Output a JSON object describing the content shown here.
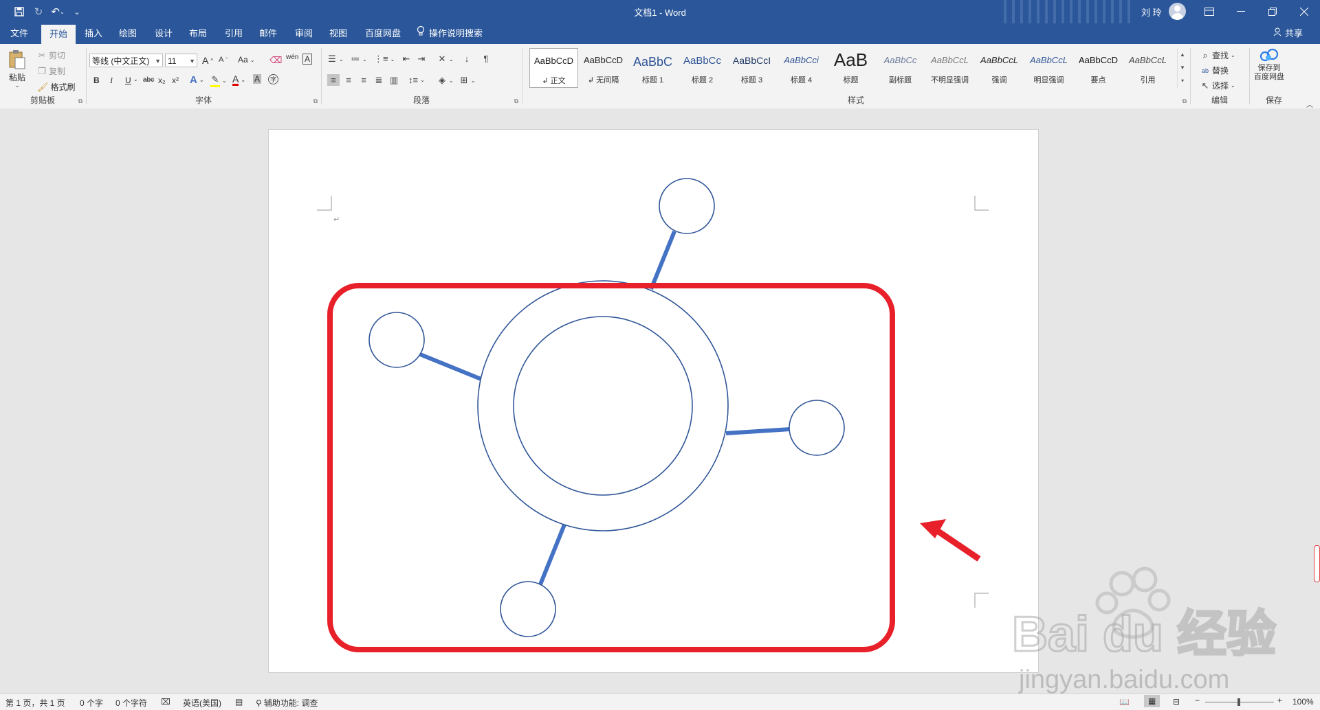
{
  "window": {
    "doc_title": "文档1  -  Word",
    "user_name": "刘 玲",
    "icons": [
      "save-icon",
      "redo-icon",
      "undo-icon",
      "customize-icon",
      "ribbon-display-icon",
      "minimize-icon",
      "restore-icon",
      "close-icon"
    ]
  },
  "tabs": [
    {
      "label": "文件",
      "active": false
    },
    {
      "label": "开始",
      "active": true
    },
    {
      "label": "插入",
      "active": false
    },
    {
      "label": "绘图",
      "active": false
    },
    {
      "label": "设计",
      "active": false
    },
    {
      "label": "布局",
      "active": false
    },
    {
      "label": "引用",
      "active": false
    },
    {
      "label": "邮件",
      "active": false
    },
    {
      "label": "审阅",
      "active": false
    },
    {
      "label": "视图",
      "active": false
    },
    {
      "label": "百度网盘",
      "active": false
    }
  ],
  "tell_me": "操作说明搜索",
  "share": "共享",
  "clipboard": {
    "paste": "粘贴",
    "cut": "剪切",
    "copy": "复制",
    "format_painter": "格式刷",
    "label": "剪贴板"
  },
  "font": {
    "name": "等线 (中文正文)",
    "size": "11",
    "grow": "A",
    "shrink": "A",
    "case": "Aa",
    "label": "字体",
    "bold": "B",
    "italic": "I",
    "underline": "U",
    "strike": "abc",
    "sub": "x₂",
    "sup": "x²"
  },
  "paragraph": {
    "label": "段落"
  },
  "styles": {
    "label": "样式",
    "items": [
      {
        "sample": "AaBbCcD",
        "name": "↲ 正文",
        "color": "#222",
        "size": "13px",
        "italic": false,
        "selected": true
      },
      {
        "sample": "AaBbCcD",
        "name": "↲ 无间隔",
        "color": "#222",
        "size": "13px",
        "italic": false,
        "selected": false
      },
      {
        "sample": "AaBbC",
        "name": "标题 1",
        "color": "#2f5496",
        "size": "18px",
        "italic": false,
        "selected": false
      },
      {
        "sample": "AaBbCc",
        "name": "标题 2",
        "color": "#2f5496",
        "size": "15px",
        "italic": false,
        "selected": false
      },
      {
        "sample": "AaBbCcI",
        "name": "标题 3",
        "color": "#1f3763",
        "size": "14px",
        "italic": false,
        "selected": false
      },
      {
        "sample": "AaBbCci",
        "name": "标题 4",
        "color": "#2f5496",
        "size": "13px",
        "italic": true,
        "selected": false
      },
      {
        "sample": "AaB",
        "name": "标题",
        "color": "#222",
        "size": "26px",
        "italic": false,
        "selected": false
      },
      {
        "sample": "AaBbCc",
        "name": "副标题",
        "color": "#6b7b9b",
        "size": "13px",
        "italic": true,
        "selected": false
      },
      {
        "sample": "AaBbCcL",
        "name": "不明显强调",
        "color": "#777",
        "size": "13px",
        "italic": true,
        "selected": false
      },
      {
        "sample": "AaBbCcL",
        "name": "强调",
        "color": "#222",
        "size": "13px",
        "italic": true,
        "selected": false
      },
      {
        "sample": "AaBbCcL",
        "name": "明显强调",
        "color": "#2f5496",
        "size": "13px",
        "italic": true,
        "selected": false
      },
      {
        "sample": "AaBbCcD",
        "name": "要点",
        "color": "#111",
        "size": "13px",
        "italic": false,
        "selected": false
      },
      {
        "sample": "AaBbCcL",
        "name": "引用",
        "color": "#444",
        "size": "13px",
        "italic": true,
        "selected": false
      }
    ]
  },
  "editing": {
    "find": "查找",
    "replace": "替换",
    "select": "选择",
    "label": "编辑"
  },
  "save_group": {
    "button": "保存到\n百度网盘",
    "label": "保存"
  },
  "status": {
    "page": "第 1 页，共 1 页",
    "words": "0 个字",
    "chars": "0 个字符",
    "language": "英语(美国)",
    "accessibility": "辅助功能: 调查",
    "zoom": "100%"
  },
  "colors": {
    "accent": "#2b579a",
    "shape_stroke": "#2f5597",
    "connector": "#4472c4",
    "highlight_box": "#e8202a",
    "arrow": "#e8202a"
  },
  "watermark": {
    "logo": "Bai du 经验",
    "url": "jingyan.baidu.com"
  }
}
